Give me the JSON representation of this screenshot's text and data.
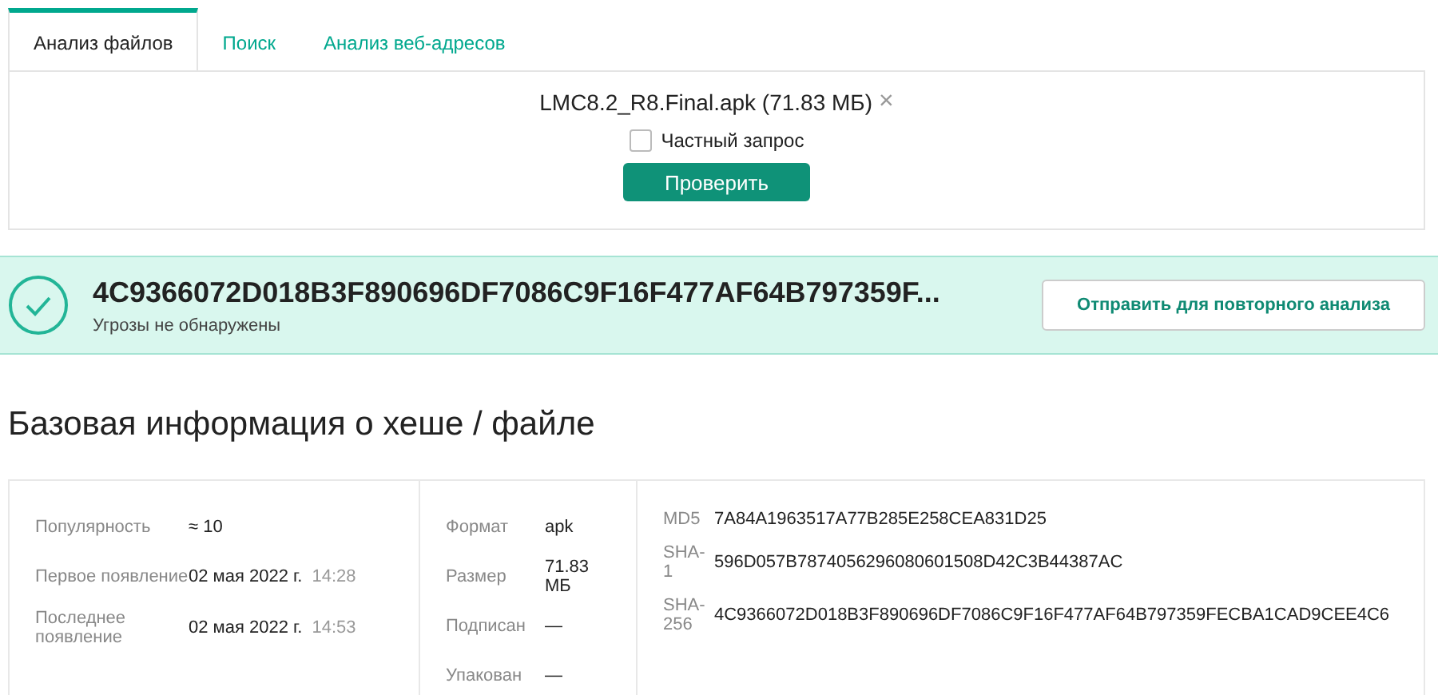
{
  "tabs": [
    {
      "label": "Анализ файлов",
      "selected": true
    },
    {
      "label": "Поиск",
      "selected": false
    },
    {
      "label": "Анализ веб-адресов",
      "selected": false
    }
  ],
  "upload": {
    "file_name": "LMC8.2_R8.Final.apk (71.83 МБ)",
    "remove": "×",
    "private_request": {
      "label": "Частный запрос",
      "checked": false
    },
    "submit": "Проверить"
  },
  "result": {
    "hash": "4C9366072D018B3F890696DF7086C9F16F477AF64B797359F...",
    "status": "Угрозы не обнаружены",
    "resubmit": "Отправить для повторного анализа"
  },
  "heading": "Базовая информация о хеше / файле",
  "stats": [
    {
      "label": "Популярность",
      "value": "≈ 10"
    },
    {
      "label": "Первое появление",
      "value": "02 мая 2022 г.",
      "time": "14:28"
    },
    {
      "label": "Последнее появление",
      "value": "02 мая 2022 г.",
      "time": "14:53"
    }
  ],
  "properties": [
    {
      "label": "Формат",
      "value": "apk"
    },
    {
      "label": "Размер",
      "value": "71.83 МБ"
    },
    {
      "label": "Подписан",
      "value": "—"
    },
    {
      "label": "Упакован",
      "value": "—"
    }
  ],
  "hashes": [
    {
      "label": "MD5",
      "value": "7A84A1963517A77B285E258CEA831D25"
    },
    {
      "label": "SHA-1",
      "value": "596D057B7874056296080601508D42C3B44387AC"
    },
    {
      "label": "SHA-256",
      "value": "4C9366072D018B3F890696DF7086C9F16F477AF64B797359FECBA1CAD9CEE4C6"
    }
  ]
}
